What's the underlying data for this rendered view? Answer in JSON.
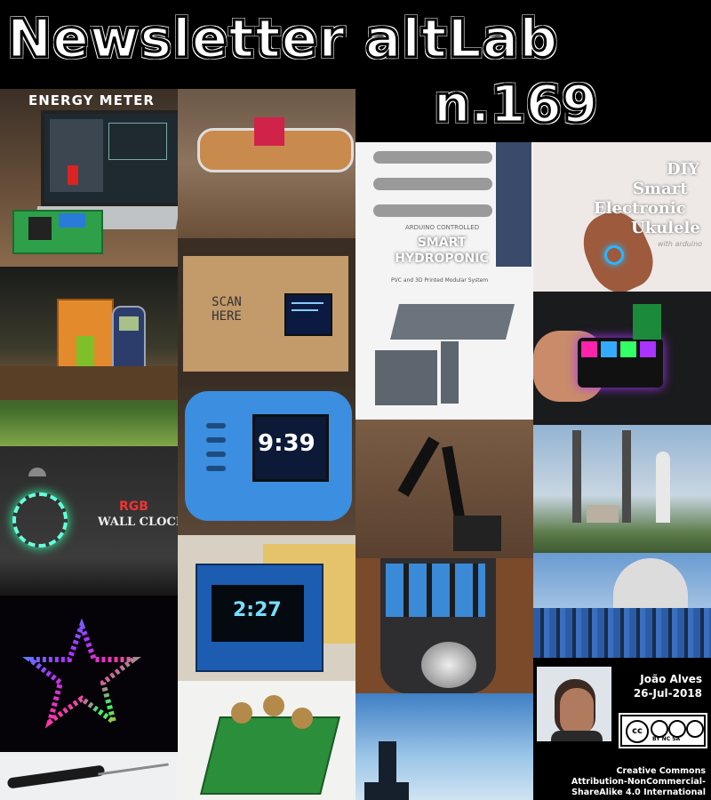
{
  "newsletter": {
    "title": "Newsletter altLab",
    "issue": "n.169"
  },
  "tiles": {
    "energy_meter": "ENERGY METER",
    "scan_here": "SCAN HERE",
    "hydroponic_small": "ARDUINO CONTROLLED",
    "hydroponic_big": "SMART HYDROPONIC",
    "hydroponic_sub": "PVC and 3D Printed Modular System",
    "ukulele_line1": "DIY",
    "ukulele_line2": "Smart",
    "ukulele_line3": "Electronic",
    "ukulele_line4": "Ukulele",
    "ukulele_sub": "with arduino",
    "clock_time": "9:39",
    "wall_clock_rgb": "RGB",
    "wall_clock": "WALL CLOCK",
    "oled_time": "2:27"
  },
  "author": {
    "name": "João Alves",
    "date": "26-Jul-2018"
  },
  "license": {
    "line1": "Creative Commons",
    "line2": "Attribution-NonCommercial-",
    "line3": "ShareAlike 4.0 International",
    "badge": "BY NC SA"
  }
}
